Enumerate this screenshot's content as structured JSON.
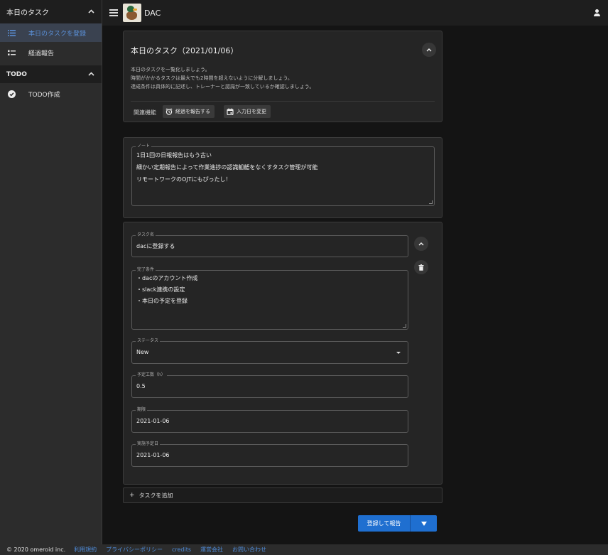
{
  "sidebar": {
    "section_today": "本日のタスク",
    "items": [
      {
        "label": "本日のタスクを登録",
        "icon": "list-icon",
        "active": true
      },
      {
        "label": "経過報告",
        "icon": "checklist-icon",
        "active": false
      }
    ],
    "section_todo": "TODO",
    "todo_items": [
      {
        "label": "TODO作成",
        "icon": "check-circle-icon"
      }
    ]
  },
  "topbar": {
    "title": "DAC",
    "menu_icon": "menu-icon",
    "logo": "duck-logo",
    "account_icon": "person-icon"
  },
  "info_card": {
    "title": "本日のタスク（2021/01/06）",
    "description": [
      "本日のタスクを一覧化しましょう。",
      "時間がかかるタスクは最大でも2時間を超えないように分解しましょう。",
      "達成条件は具体的に記述し、トレーナーと認識が一致しているか確認しましょう。"
    ],
    "related_label": "関連機能",
    "chip_report": "経過を報告する",
    "chip_date": "入力日を変更"
  },
  "note": {
    "label": "ノート",
    "lines": [
      "1日1回の日報報告はもう古い",
      "細かい定期報告によって作業進捗の認識齟齬をなくすタスク管理が可能",
      "リモートワークのOJTにもぴったし！"
    ]
  },
  "task": {
    "name_label": "タスク名",
    "name_value": "dacに登録する",
    "condition_label": "完了条件",
    "condition_lines": [
      "・dacのアカウント作成",
      "・slack連携の設定",
      "・本日の予定を登録"
    ],
    "status_label": "ステータス",
    "status_value": "New",
    "estimate_label": "予定工数（h）",
    "estimate_value": "0.5",
    "deadline_label": "期限",
    "deadline_value": "2021-01-06",
    "planned_label": "実施予定日",
    "planned_value": "2021-01-06"
  },
  "add_task_label": "タスクを追加",
  "submit_label": "登録して報告",
  "footer": {
    "copyright": "© 2020 omeroid inc.",
    "links": [
      "利用規約",
      "プライバシーポリシー",
      "credits",
      "運営会社",
      "お問い合わせ"
    ]
  },
  "colors": {
    "accent": "#1f6fd0",
    "link": "#4f8bd8",
    "active_nav": "#5a8fd6"
  }
}
